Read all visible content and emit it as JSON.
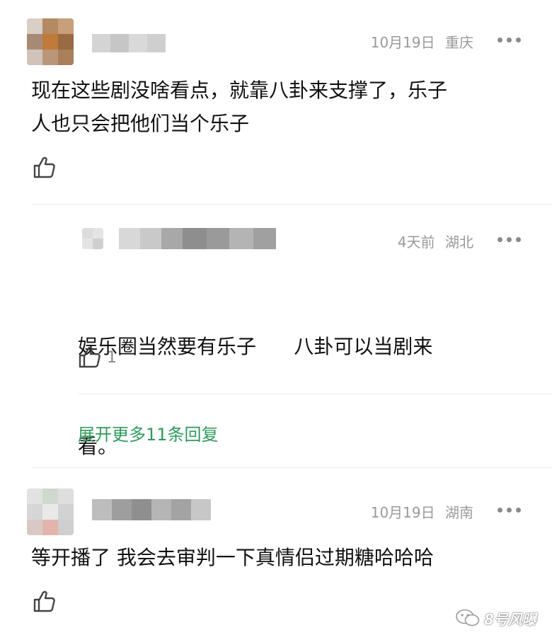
{
  "comments": [
    {
      "date": "10月19日",
      "location": "重庆",
      "text_lines": [
        "现在这些剧没啥看点，就靠八卦来支撑了，乐子",
        "人也只会把他们当个乐子"
      ],
      "likes": ""
    },
    {
      "date": "10月19日",
      "location": "湖南",
      "text_lines": [
        "等开播了 我会去审判一下真情侣过期糖哈哈哈"
      ],
      "likes": ""
    }
  ],
  "reply": {
    "date": "4天前",
    "location": "湖北",
    "text_lines": [
      "娱乐圈当然要有乐子      八卦可以当剧来",
      "看。"
    ],
    "likes": "1"
  },
  "expand_label": "展开更多11条回复",
  "watermark": "8号风曝",
  "colors": {
    "accent_green": "#2e9a5a",
    "meta_gray": "#9a9a9a"
  }
}
